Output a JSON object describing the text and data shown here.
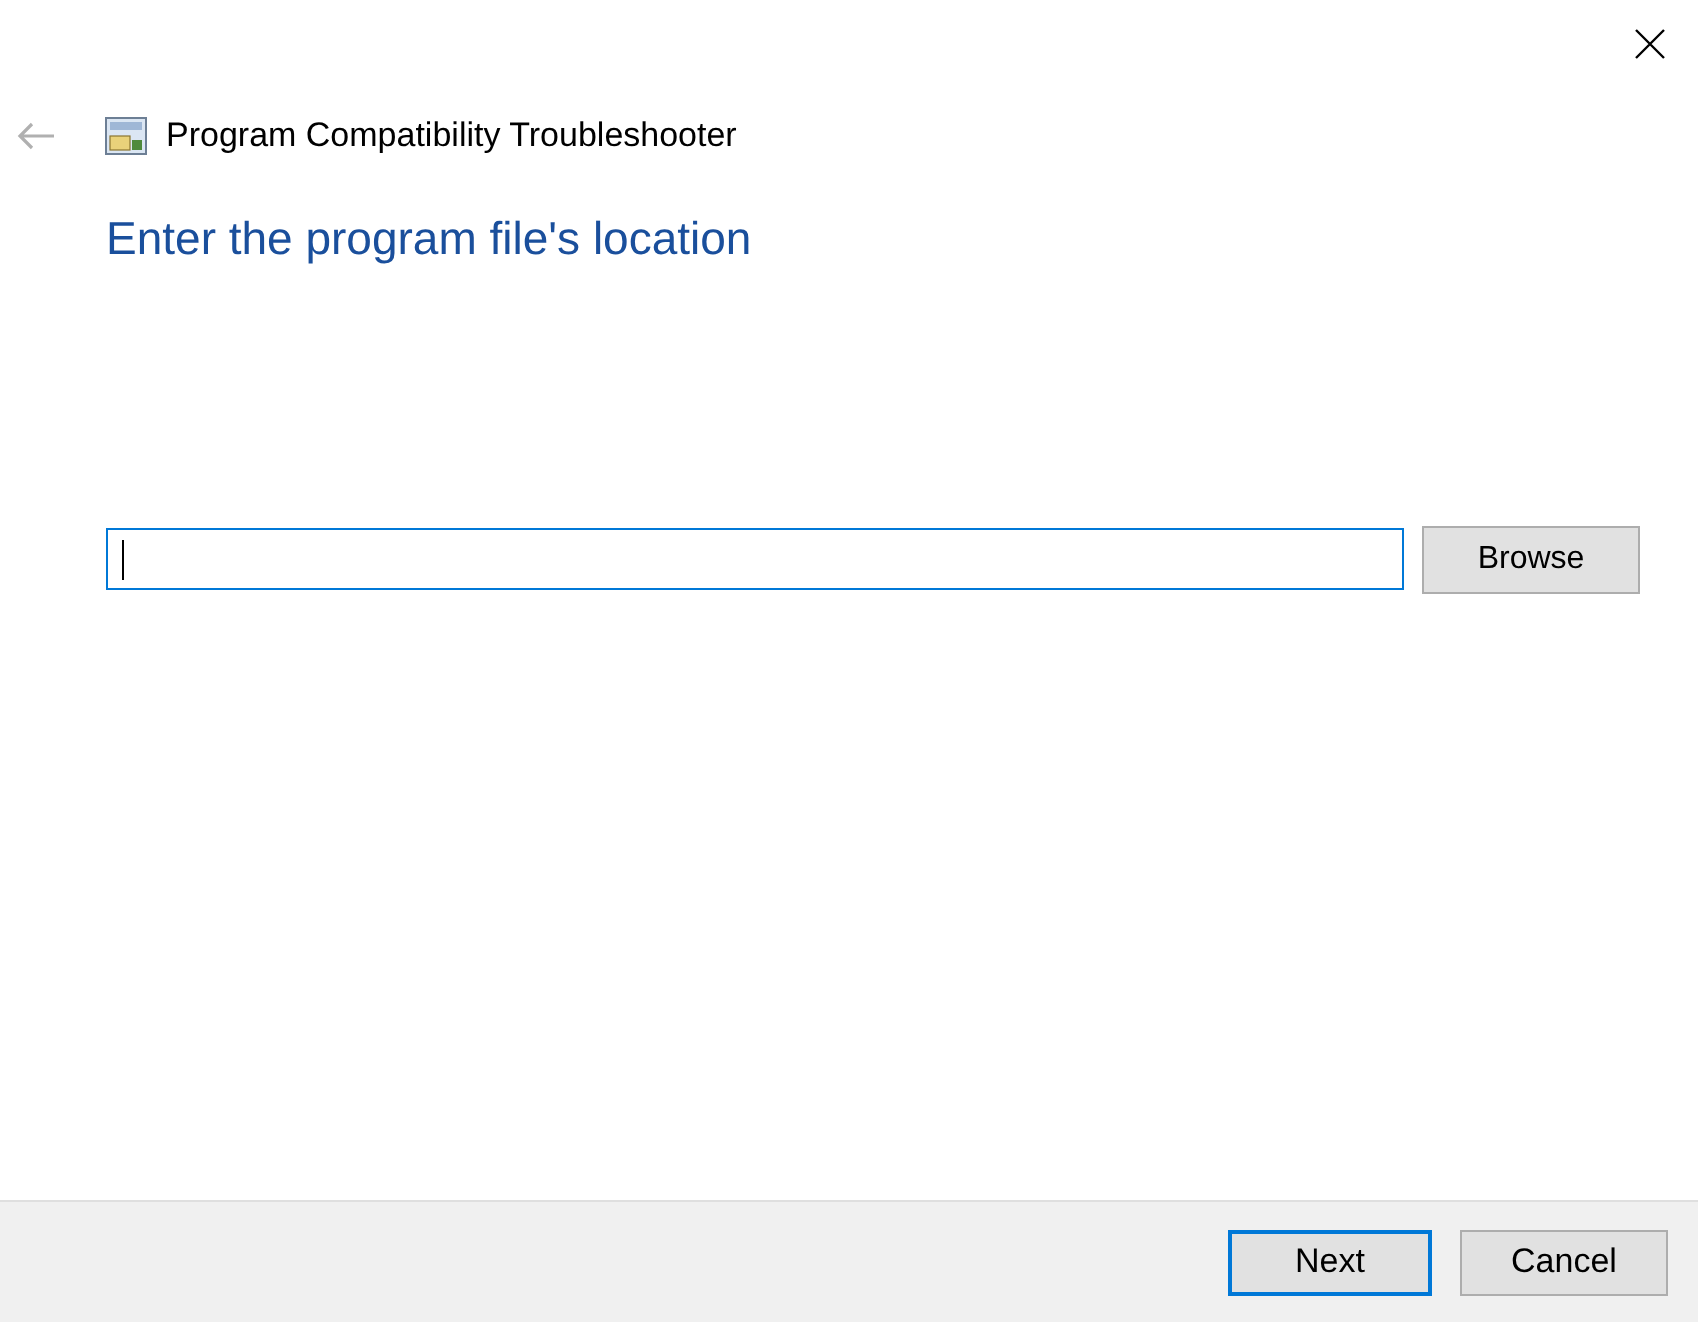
{
  "window": {
    "title": "Program Compatibility Troubleshooter",
    "back_disabled": true
  },
  "heading": "Enter the program file's location",
  "location_field": {
    "focused": true
  },
  "browse_button": "Browse",
  "buttons": [
    {
      "label": "Next",
      "default": true
    },
    {
      "label": "Cancel",
      "default": false
    }
  ]
}
